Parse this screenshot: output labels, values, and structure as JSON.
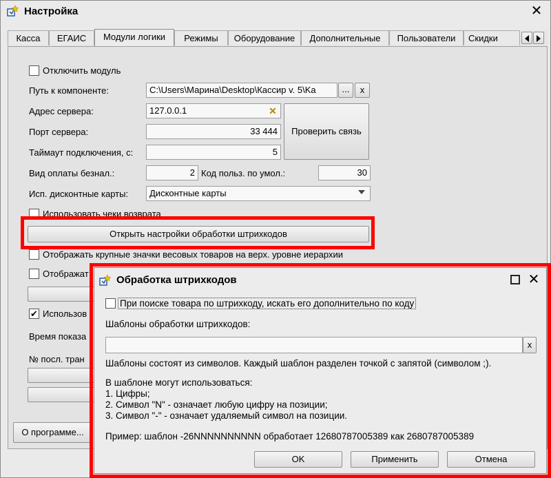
{
  "main_window": {
    "title": "Настройка",
    "tabs": [
      "Касса",
      "ЕГАИС",
      "Модули логики",
      "Режимы",
      "Оборудование",
      "Дополнительные",
      "Пользователи",
      "Скидки"
    ],
    "active_tab": "Модули логики",
    "form": {
      "disable_module_label": "Отключить модуль",
      "component_path_label": "Путь к компоненте:",
      "component_path_value": "C:\\Users\\Марина\\Desktop\\Кассир v. 5\\Ka",
      "browse_label": "...",
      "clear_label": "x",
      "server_address_label": "Адрес сервера:",
      "server_address_value": "127.0.0.1",
      "server_port_label": "Порт сервера:",
      "server_port_value": "33 444",
      "check_connection_label": "Проверить связь",
      "timeout_label": "Таймаут подключения, с:",
      "timeout_value": "5",
      "cashless_payment_label": "Вид оплаты безнал.:",
      "cashless_payment_value": "2",
      "default_user_code_label": "Код польз. по умол.:",
      "default_user_code_value": "30",
      "discount_cards_label": "Исп. дисконтные карты:",
      "discount_cards_value": "Дисконтные карты",
      "use_return_checks_label": "Использовать чеки возврата",
      "open_barcode_settings_label": "Открыть настройки обработки штрихкодов",
      "show_large_icons_label": "Отображать крупные значки весовых товаров на верх. уровне иерархии",
      "show_partial_label": "Отображат",
      "use_partial_label": "Использов",
      "show_time_partial_label": "Время показа",
      "last_trans_partial_label": "№ посл. тран",
      "about_label": "О программе..."
    }
  },
  "dialog": {
    "title": "Обработка штрихкодов",
    "search_by_code_label": "При поиске товара по штрихкоду, искать его дополнительно по коду",
    "templates_label": "Шаблоны обработки штрихкодов:",
    "templates_value": "",
    "clear_label": "x",
    "info_line1": "Шаблоны состоят из символов. Каждый шаблон разделен точкой с запятой (символом ;).",
    "info_line2": "В шаблоне могут использоваться:",
    "info_line3": "1. Цифры;",
    "info_line4": "2. Символ \"N\" - означает любую цифру на позиции;",
    "info_line5": "3. Символ \"-\" - означает удаляемый символ на позиции.",
    "example": "Пример: шаблон -26NNNNNNNNNN обработает 12680787005389 как 2680787005389",
    "ok_label": "OK",
    "apply_label": "Применить",
    "cancel_label": "Отмена"
  },
  "colors": {
    "highlight": "#ff0000",
    "window_bg": "#eaeaea"
  }
}
